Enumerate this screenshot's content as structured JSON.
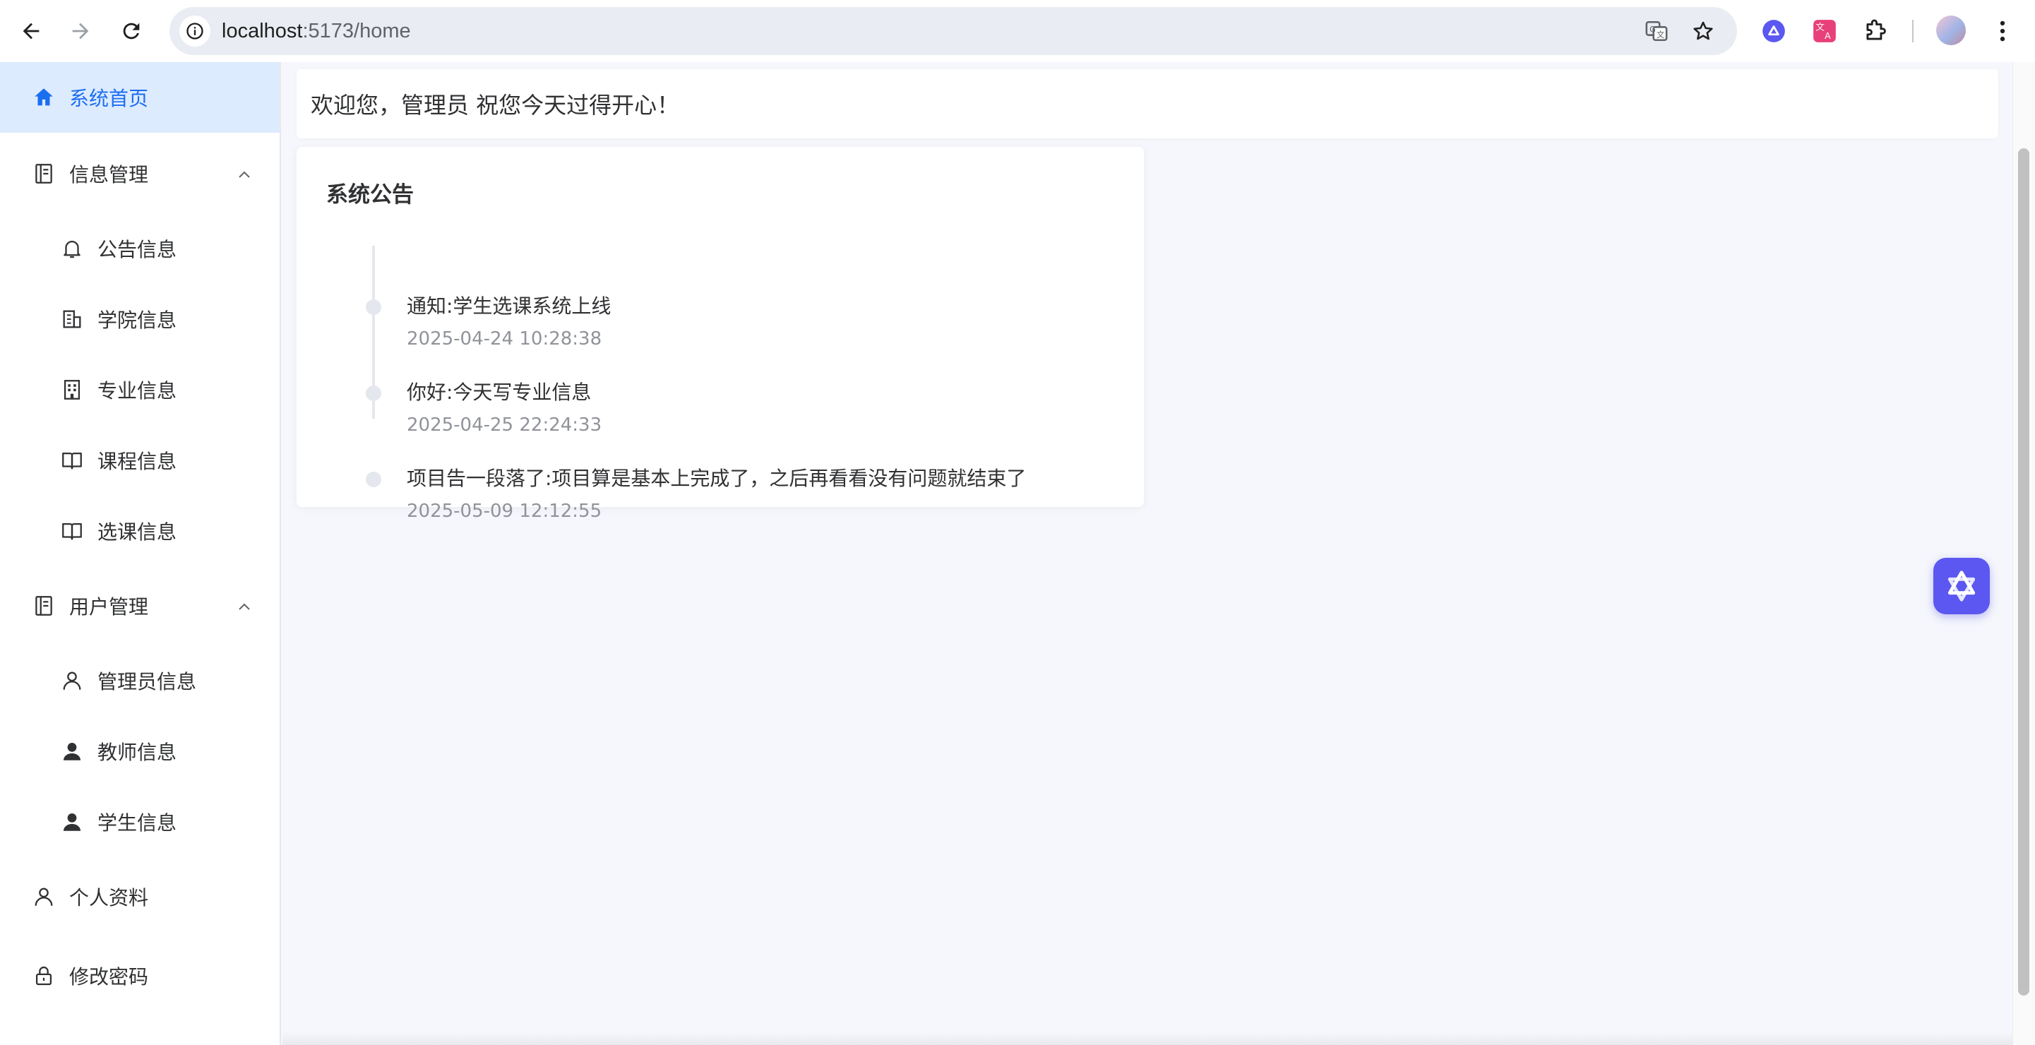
{
  "browser": {
    "url_host": "localhost",
    "url_path": ":5173/home",
    "colors": {
      "toolbar_bg": "#ffffff",
      "omnibox_bg": "#e9ecf2"
    }
  },
  "sidebar": {
    "items": [
      {
        "label": "系统首页",
        "icon": "home-icon",
        "active": true
      },
      {
        "label": "信息管理",
        "icon": "document-list-icon",
        "expanded": true
      },
      {
        "label": "公告信息",
        "icon": "bell-icon"
      },
      {
        "label": "学院信息",
        "icon": "building-icon"
      },
      {
        "label": "专业信息",
        "icon": "office-building-icon"
      },
      {
        "label": "课程信息",
        "icon": "book-icon"
      },
      {
        "label": "选课信息",
        "icon": "book-icon"
      },
      {
        "label": "用户管理",
        "icon": "document-list-icon",
        "expanded": true
      },
      {
        "label": "管理员信息",
        "icon": "user-outline-icon"
      },
      {
        "label": "教师信息",
        "icon": "user-filled-icon"
      },
      {
        "label": "学生信息",
        "icon": "user-filled-icon"
      },
      {
        "label": "个人资料",
        "icon": "user-outline-icon"
      },
      {
        "label": "修改密码",
        "icon": "lock-icon"
      }
    ],
    "colors": {
      "active_bg": "#ddebff",
      "active_text": "#1c6ef0"
    }
  },
  "main": {
    "welcome": "欢迎您，管理员 祝您今天过得开心！",
    "notice_card": {
      "title": "系统公告",
      "items": [
        {
          "content": "通知:学生选课系统上线",
          "time": "2025-04-24 10:28:38"
        },
        {
          "content": "你好:今天写专业信息",
          "time": "2025-04-25 22:24:33"
        },
        {
          "content": "项目告一段落了:项目算是基本上完成了，之后再看看没有问题就结束了",
          "time": "2025-05-09 12:12:55"
        }
      ]
    }
  }
}
